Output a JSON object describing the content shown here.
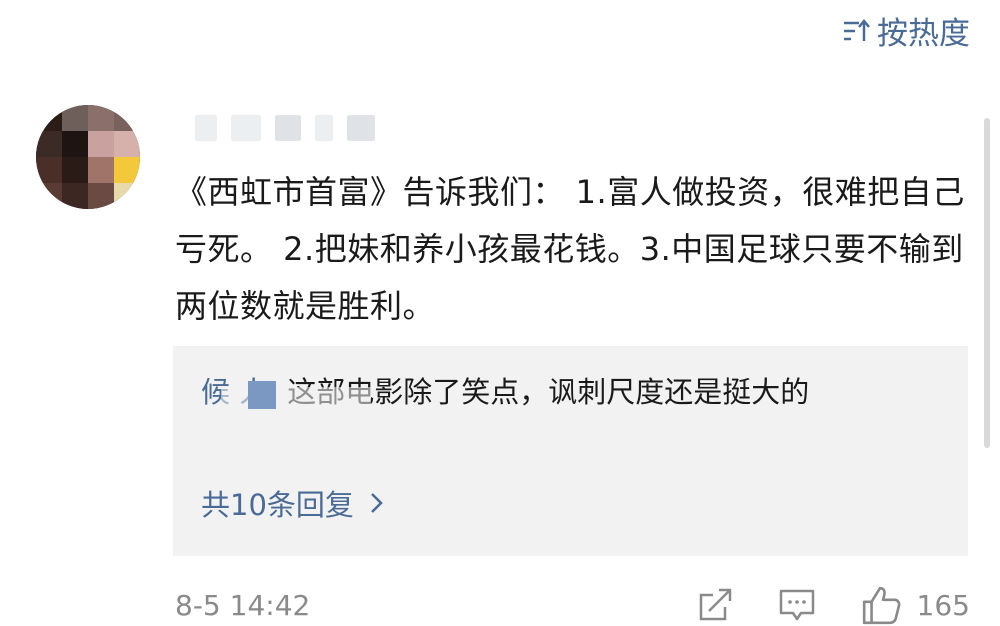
{
  "sort": {
    "label": "按热度",
    "icon": "sort-icon"
  },
  "comment": {
    "avatar_icon": "avatar-pixelated",
    "text": "《西虹市首富》告诉我们： 1.富人做投资，很难把自己亏死。 2.把妹和养小孩最花钱。3.中国足球只要不输到两位数就是胜利。",
    "timestamp": "8-5 14:42",
    "likes": "165"
  },
  "reply": {
    "author": "候  人",
    "text": ": 这部电影除了笑点，讽刺尺度还是挺大的",
    "more_label": "共10条回复",
    "more_icon": "chevron-right-icon"
  },
  "actions": {
    "share_icon": "share-edit-icon",
    "comment_icon": "comment-icon",
    "like_icon": "thumbs-up-icon"
  },
  "colors": {
    "link": "#4a6b96",
    "reply_bg": "#f2f2f2",
    "meta": "#8a8a8a",
    "text": "#1a1a1a"
  }
}
